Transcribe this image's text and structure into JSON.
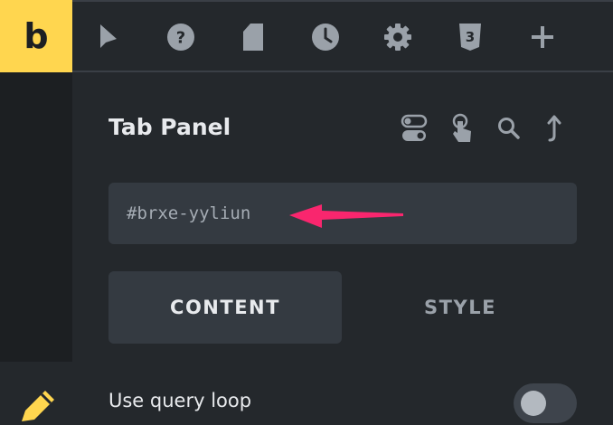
{
  "toolbar": {
    "logo_text": "b",
    "tools": [
      "pointer-icon",
      "help-icon",
      "page-icon",
      "history-icon",
      "settings-icon",
      "css3-icon",
      "plus-icon"
    ]
  },
  "panel": {
    "title": "Tab Panel",
    "actions": [
      "toggle-icon",
      "hand-pointer-icon",
      "search-icon",
      "arrow-up-icon"
    ],
    "element_id": "#brxe-yyliun"
  },
  "tabs": {
    "content_label": "CONTENT",
    "style_label": "STYLE",
    "active": "CONTENT"
  },
  "settings": {
    "query_loop_label": "Use query loop",
    "query_loop_enabled": false
  },
  "colors": {
    "logo_bg": "#ffd64f",
    "background": "#24282c",
    "field_bg": "#343a41",
    "annotation_arrow": "#f9266e"
  }
}
